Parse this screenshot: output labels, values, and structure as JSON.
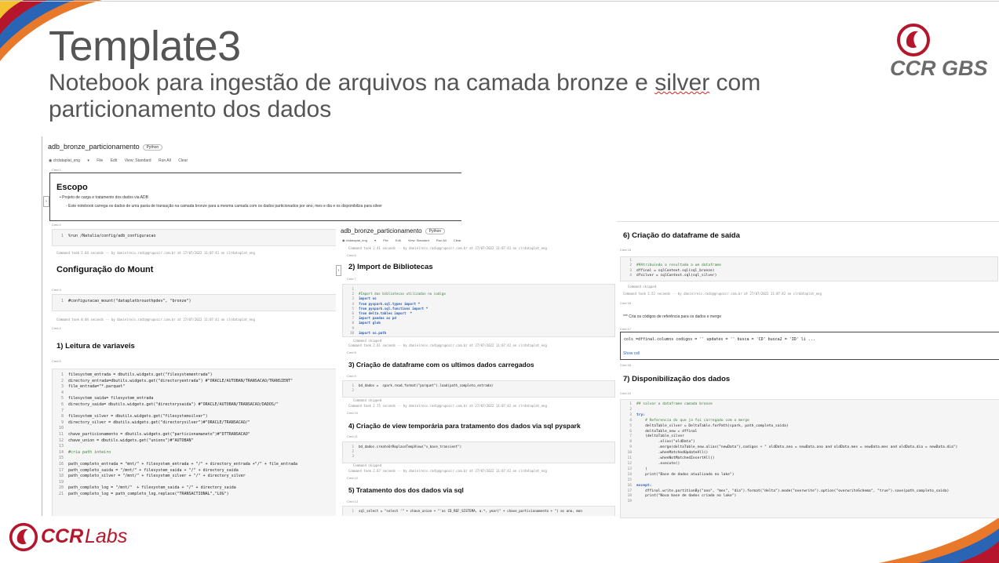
{
  "slide": {
    "title": "Template3",
    "subtitle_pre": "Notebook para ingestão de arquivos na camada bronze e ",
    "subtitle_squig": "silver",
    "subtitle_post": " com particionamento dos dados"
  },
  "logos": {
    "top_right": "CCR GBS",
    "bottom_left_ccr": "CCR",
    "bottom_left_labs": "Labs"
  },
  "colors": {
    "brand_red": "#b5162b",
    "brand_gray": "#6b6b6b",
    "accent_orange": "#e8792a",
    "accent_blue": "#2a64b5"
  },
  "left_nb": {
    "name": "adb_bronze_particionamento",
    "lang": "Python",
    "cluster": "clrdataplat_eng",
    "toolbar": [
      "File",
      "Edit",
      "View: Standard",
      "Run All",
      "Clear"
    ],
    "cmd1": "Cmd 1",
    "escopo_title": "Escopo",
    "escopo_b1": "Projeto de carga e tratamento dos dados via ADB",
    "escopo_b2": "Este notebook carrega os dados de uma pasta de transação na camada bronze para a mesma camada com os dados particionados por ano, mes e dia e os disponibiliza para silver",
    "cmd2": "Cmd 2",
    "code2": "%run /Natalia/config/adb_configuracao",
    "foot2": "Command took 2.64 seconds -- by danielreis.radi@grupoccr.com.br at 27/07/2022 11:07:41 on clrdataplat_eng",
    "h_mount": "Configuração do Mount",
    "cmd3": "Cmd 3",
    "code3": "#configuracao_mount(\"dataplatbrouothpdev\", \"bronze\")",
    "foot3": "Command took 0.04 seconds -- by danielreis.radi@grupoccr.com.br at 27/07/2022 11:07:41 on clrdataplat_eng",
    "cmd4": "Cmd 4",
    "h_leitura": "1) Leitura de variaveis",
    "cmd5": "Cmd 5",
    "code5": [
      "filesystem_entrada = dbutils.widgets.get(\"filesystementrada\")",
      "directory_entrada=dbutils.widgets.get(\"directoryentrada\") #\"ORACLE/AUTOBAN/TRANSACAO/TRANSIENT\"",
      "file_entrada=\"*.parquet\"",
      "",
      "filesystem_saida= filesystem_entrada",
      "directory_saida= dbutils.widgets.get(\"directorysaida\") #\"ORACLE/AUTOBAN/TRANSACAO/DADOS/\"",
      "",
      "filesystem_silver = dbutils.widgets.get(\"filesystemsilver\")",
      "directory_silver = dbutils.widgets.get(\"directorysilver\")#\"ORACLE/TRANSACAO/\"",
      "",
      "chave_particionamento = dbutils.widgets.get(\"particionamaneto\")#\"DTTRANSACAO\"",
      "chave_union = dbutils.widgets.get(\"unionx\")#\"AUTOBAN\"",
      "",
      "#cria path inteiro",
      "",
      "path_completo_entrada = \"mnt/\" + filesystem_entrada + \"/\" + directory_entrada +\"/\" + file_entrada",
      "path_completo_saida = \"/mnt/\" + filesystem_saida + \"/\" + directory_saida",
      "path_completo_silver = \"/mnt/\" + filesystem_silver + \"/\" + directory_silver",
      "",
      "path_completo_log = \"/mnt/\"  + filesystem_saida + \"/\" + directory_saida",
      "path_completo_log = path_completo_log.replace(\"TRANSACTIONAL\",\"LOG\")"
    ]
  },
  "mid_nb": {
    "name": "adb_bronze_particionamento",
    "lang": "Python",
    "cluster": "clrdataplat_eng",
    "toolbar": [
      "File",
      "Edit",
      "View: Standard",
      "Run All",
      "Clear"
    ],
    "foot0": "Command took 2.41 seconds -- by danielreis.radi@grupoccr.com.br at 27/07/2022 11:07:41 on clrdataplat_eng",
    "cmd6": "Cmd 6",
    "h_import": "2) Import de Bibliotecas",
    "cmd7": "Cmd 7",
    "code7": [
      "",
      "#Import das bibliotecas utilizadas no codigo",
      "import os",
      "from pyspark.sql.types import *",
      "from pyspark.sql.functions import *",
      "from delta.tables import  *",
      "import pandas as pd",
      "import glob",
      "",
      "import os.path"
    ],
    "skip7": "Command skipped",
    "foot7": "Command took 2.61 seconds -- by danielreis.radi@grupoccr.com.br at 27/07/2022 11:07:42 on clrdataplat_eng",
    "cmd8": "Cmd 8",
    "h_df": "3) Criação de dataframe com os ultimos dados carregados",
    "cmd9": "Cmd 9",
    "code9": [
      "bd_dados =  spark.read.format(\"parquet\").load(path_completo_entrada)",
      ""
    ],
    "skip9": "Command skipped",
    "foot9": "Command took 2.75 seconds -- by danielreis.radi@grupoccr.com.br at 27/07/2022 11:07:42 on clrdataplat_eng",
    "cmd10": "Cmd 10",
    "h_view": "4) Criação de view temporária para tratamento dos dados via sql pyspark",
    "cmd11": "Cmd 11",
    "code11": [
      "bd_dados.createOrReplaceTempView(\"v_base_transient\")",
      "",
      ""
    ],
    "skip11": "Command skipped",
    "foot11": "Command took 2.67 seconds -- by danielreis.radi@grupoccr.com.br at 27/07/2022 11:07:42 on clrdataplat_eng",
    "cmd12": "Cmd 12",
    "h_trat": "5) Tratamento dos dos dados via sql",
    "cmd13": "Cmd 13",
    "code13": "sql_select = \"select '\" + chave_union + \"'as CD_REF_SISTEMA, a.*, year(\" + chave_particionamento + \") as ano, mon"
  },
  "right_nb": {
    "h_saida": "6) Criação do dataframe de saída",
    "cmd15": "Cmd 15",
    "code15": [
      "",
      "##Atribuindo o resultado a um dataframe",
      "dffinal = sqlContext.sql(sql_bronze)",
      "dfsilver = sqlContext.sql(sql_silver)"
    ],
    "skip15": "Command skipped",
    "foot15": "Command took 2.52 seconds -- by danielreis.radi@grupoccr.com.br at 27/07/2022 11:07:42 on clrdataplat_eng",
    "cmd16": "Cmd 16",
    "md16": "*** Cria os códigos de referência para os dados e merge",
    "cmd17": "Cmd 17",
    "code17": "cols =dffinal.columns  codigos = '' updates = ''  busca = 'CD' busca2 = 'ID' li ...",
    "showcell": "Show cell",
    "cmd18": "Cmd 18",
    "h_disp": "7) Disponibilização dos dados",
    "cmd19": "Cmd 19",
    "code19": [
      "## salvar o dataframe camada bronze",
      "",
      "try:",
      "    # Referencia do que ja foi carregado com o merge",
      "    deltaTable_silver = DeltaTable.forPath(spark, path_completo_saida)",
      "    deltaTable_new = dffinal",
      "    (deltaTable_silver",
      "          .alias(\"oldData\")",
      "          .merge(deltaTable_new.alias(\"newData\"),codigos + \" oldData.ano = newData.ano and oldData.mes = newData.mes and oldData.dia = newData.dia\")",
      "          .whenMatchedUpdateAll()",
      "          .whenNotMatchedInsertAll()",
      "          .execute()",
      "    )",
      "    print(\"Base de dados atualizada no lake\")",
      "",
      "except:",
      "    dffinal.write.partitionBy(\"ano\", \"mes\", \"dia\").format(\"delta\").mode(\"overwrite\").option(\"overwriteSchema\", \"true\").save(path_completo_saida)",
      "    print(\"Nova base de dados criada no lake\")",
      ""
    ]
  }
}
